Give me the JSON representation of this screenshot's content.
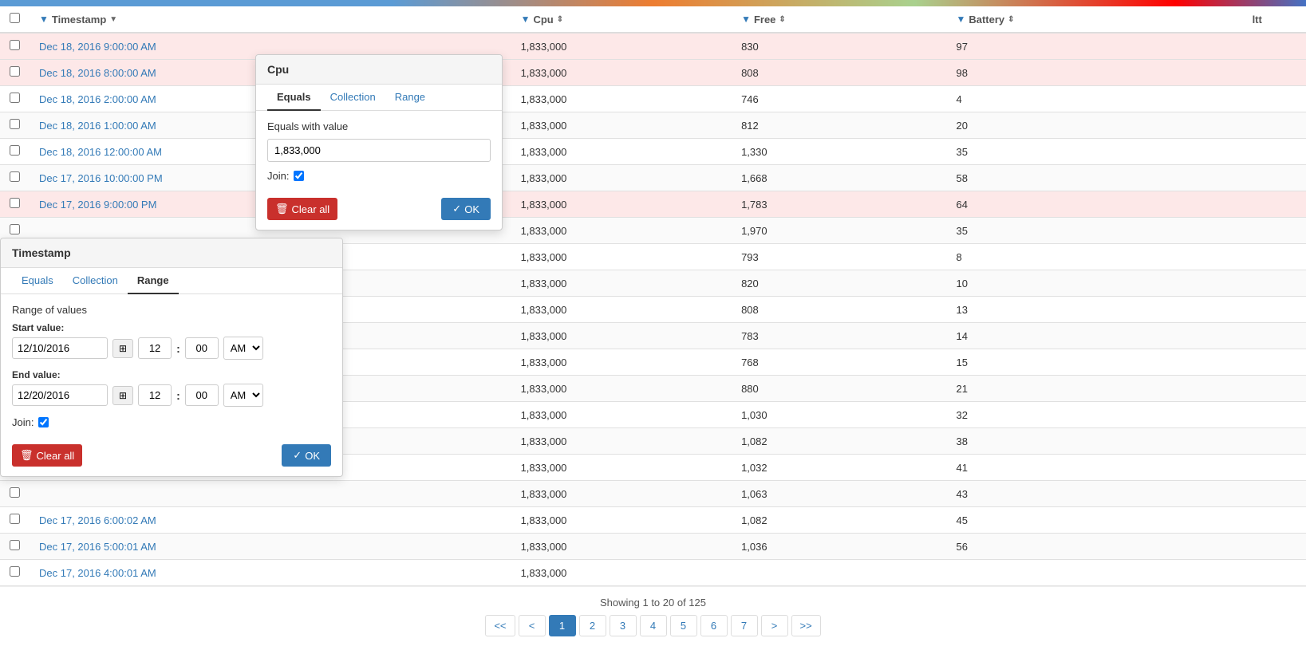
{
  "topbar": {},
  "table": {
    "columns": [
      {
        "id": "checkbox",
        "label": ""
      },
      {
        "id": "timestamp",
        "label": "Timestamp",
        "filterable": true,
        "sortable": true
      },
      {
        "id": "cpu",
        "label": "Cpu",
        "filterable": true,
        "sortable": true
      },
      {
        "id": "free",
        "label": "Free",
        "filterable": true,
        "sortable": true
      },
      {
        "id": "battery",
        "label": "Battery",
        "filterable": true,
        "sortable": true
      },
      {
        "id": "ltt",
        "label": "ltt",
        "filterable": false,
        "sortable": false
      }
    ],
    "rows": [
      {
        "timestamp": "Dec 18, 2016 9:00:00 AM",
        "cpu": "1,833,000",
        "free": "830",
        "battery": "97",
        "ltt": "",
        "highlighted": true
      },
      {
        "timestamp": "Dec 18, 2016 8:00:00 AM",
        "cpu": "1,833,000",
        "free": "808",
        "battery": "98",
        "ltt": "",
        "highlighted": true
      },
      {
        "timestamp": "Dec 18, 2016 2:00:00 AM",
        "cpu": "1,833,000",
        "free": "746",
        "battery": "4",
        "ltt": "",
        "highlighted": false
      },
      {
        "timestamp": "Dec 18, 2016 1:00:00 AM",
        "cpu": "1,833,000",
        "free": "812",
        "battery": "20",
        "ltt": "",
        "highlighted": false
      },
      {
        "timestamp": "Dec 18, 2016 12:00:00 AM",
        "cpu": "1,833,000",
        "free": "1,330",
        "battery": "35",
        "ltt": "",
        "highlighted": false
      },
      {
        "timestamp": "Dec 17, 2016 10:00:00 PM",
        "cpu": "1,833,000",
        "free": "1,668",
        "battery": "58",
        "ltt": "",
        "highlighted": false
      },
      {
        "timestamp": "Dec 17, 2016 9:00:00 PM",
        "cpu": "1,833,000",
        "free": "1,783",
        "battery": "64",
        "ltt": "",
        "highlighted": true
      },
      {
        "timestamp": "",
        "cpu": "1,833,000",
        "free": "1,970",
        "battery": "35",
        "ltt": "",
        "highlighted": false
      },
      {
        "timestamp": "",
        "cpu": "1,833,000",
        "free": "793",
        "battery": "8",
        "ltt": "",
        "highlighted": false
      },
      {
        "timestamp": "",
        "cpu": "1,833,000",
        "free": "820",
        "battery": "10",
        "ltt": "",
        "highlighted": false
      },
      {
        "timestamp": "",
        "cpu": "1,833,000",
        "free": "808",
        "battery": "13",
        "ltt": "",
        "highlighted": false
      },
      {
        "timestamp": "",
        "cpu": "1,833,000",
        "free": "783",
        "battery": "14",
        "ltt": "",
        "highlighted": false
      },
      {
        "timestamp": "",
        "cpu": "1,833,000",
        "free": "768",
        "battery": "15",
        "ltt": "",
        "highlighted": false
      },
      {
        "timestamp": "",
        "cpu": "1,833,000",
        "free": "880",
        "battery": "21",
        "ltt": "",
        "highlighted": false
      },
      {
        "timestamp": "",
        "cpu": "1,833,000",
        "free": "1,030",
        "battery": "32",
        "ltt": "",
        "highlighted": false
      },
      {
        "timestamp": "",
        "cpu": "1,833,000",
        "free": "1,082",
        "battery": "38",
        "ltt": "",
        "highlighted": false
      },
      {
        "timestamp": "",
        "cpu": "1,833,000",
        "free": "1,032",
        "battery": "41",
        "ltt": "",
        "highlighted": false
      },
      {
        "timestamp": "",
        "cpu": "1,833,000",
        "free": "1,063",
        "battery": "43",
        "ltt": "",
        "highlighted": false
      },
      {
        "timestamp": "Dec 17, 2016 6:00:02 AM",
        "cpu": "1,833,000",
        "free": "1,082",
        "battery": "45",
        "ltt": "",
        "highlighted": false
      },
      {
        "timestamp": "Dec 17, 2016 5:00:01 AM",
        "cpu": "1,833,000",
        "free": "1,036",
        "battery": "56",
        "ltt": "",
        "highlighted": false
      },
      {
        "timestamp": "Dec 17, 2016 4:00:01 AM",
        "cpu": "1,833,000",
        "free": "",
        "battery": "",
        "ltt": "",
        "highlighted": false
      }
    ],
    "pagination": {
      "info": "Showing 1 to 20 of 125",
      "pages": [
        "<<",
        "<",
        "1",
        "2",
        "3",
        "4",
        "5",
        "6",
        "7",
        ">",
        ">>"
      ],
      "active_page": "1"
    }
  },
  "cpu_popover": {
    "title": "Cpu",
    "tabs": [
      "Equals",
      "Collection",
      "Range"
    ],
    "active_tab": "Equals",
    "equals_label": "Equals with value",
    "equals_value": "1,833,000",
    "join_label": "Join:",
    "clear_label": "Clear all",
    "ok_label": "OK"
  },
  "timestamp_popover": {
    "title": "Timestamp",
    "tabs": [
      "Equals",
      "Collection",
      "Range"
    ],
    "active_tab": "Range",
    "range_label": "Range of values",
    "start_label": "Start value:",
    "start_date": "12/10/2016",
    "start_hour": "12",
    "start_min": "00",
    "start_ampm": "AM",
    "end_label": "End value:",
    "end_date": "12/20/2016",
    "end_hour": "12",
    "end_min": "00",
    "end_ampm": "AM",
    "join_label": "Join:",
    "clear_label": "Clear all",
    "ok_label": "OK"
  }
}
